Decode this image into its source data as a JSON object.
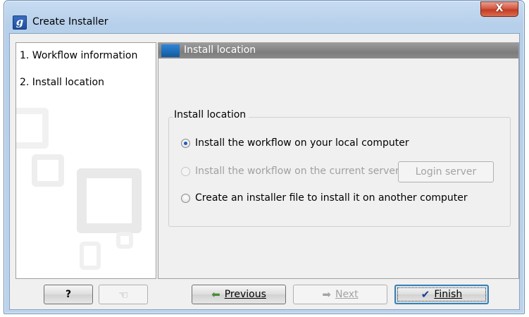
{
  "window": {
    "title": "Create Installer",
    "app_icon_letter": "g",
    "close_glyph": "X"
  },
  "sidebar": {
    "steps": [
      {
        "label": "1.  Workflow information"
      },
      {
        "label": "2.  Install location"
      }
    ]
  },
  "content": {
    "header_title": "Install location",
    "group_title": "Install location",
    "options": [
      {
        "label": "Install the workflow on your local computer",
        "checked": true,
        "enabled": true
      },
      {
        "label": "Install the workflow on the current server",
        "checked": false,
        "enabled": false
      },
      {
        "label": "Create an installer file to install it on another computer",
        "checked": false,
        "enabled": true
      }
    ],
    "login_button": "Login server"
  },
  "footer": {
    "help_label": "?",
    "previous_label": "Previous",
    "next_label": "Next",
    "finish_label": "Finish"
  },
  "colors": {
    "accent": "#1d5fb8",
    "header_bar": "#8a8a8a",
    "close_button": "#c43c24"
  }
}
